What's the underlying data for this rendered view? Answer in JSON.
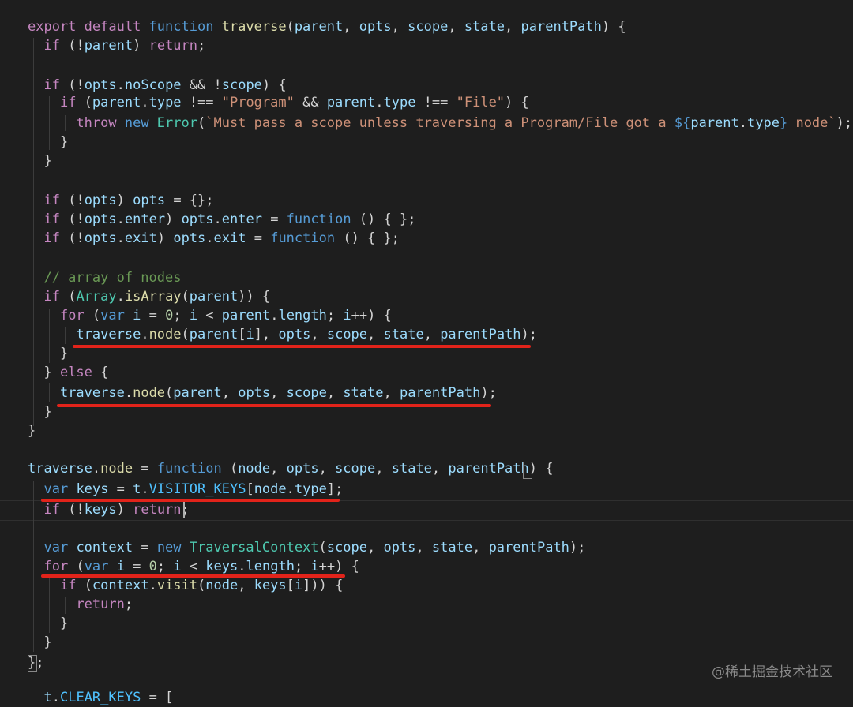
{
  "code_lines": [
    [
      [
        "export ",
        "kw"
      ],
      [
        "default ",
        "kw"
      ],
      [
        "function ",
        "st"
      ],
      [
        "traverse",
        "fn"
      ],
      [
        "(",
        "pl"
      ],
      [
        "parent",
        "var"
      ],
      [
        ", ",
        "pl"
      ],
      [
        "opts",
        "var"
      ],
      [
        ", ",
        "pl"
      ],
      [
        "scope",
        "var"
      ],
      [
        ", ",
        "pl"
      ],
      [
        "state",
        "var"
      ],
      [
        ", ",
        "pl"
      ],
      [
        "parentPath",
        "var"
      ],
      [
        ") {",
        "pl"
      ]
    ],
    [
      [
        "  ",
        "pl"
      ],
      [
        "if ",
        "kw"
      ],
      [
        "(!",
        "pl"
      ],
      [
        "parent",
        "var"
      ],
      [
        ") ",
        "pl"
      ],
      [
        "return",
        "kw"
      ],
      [
        ";",
        "pl"
      ]
    ],
    [],
    [
      [
        "  ",
        "pl"
      ],
      [
        "if ",
        "kw"
      ],
      [
        "(!",
        "pl"
      ],
      [
        "opts",
        "var"
      ],
      [
        ".",
        "pl"
      ],
      [
        "noScope",
        "var"
      ],
      [
        " && !",
        "pl"
      ],
      [
        "scope",
        "var"
      ],
      [
        ") {",
        "pl"
      ]
    ],
    [
      [
        "    ",
        "pl"
      ],
      [
        "if ",
        "kw"
      ],
      [
        "(",
        "pl"
      ],
      [
        "parent",
        "var"
      ],
      [
        ".",
        "pl"
      ],
      [
        "type",
        "var"
      ],
      [
        " !== ",
        "pl"
      ],
      [
        "\"Program\"",
        "str"
      ],
      [
        " && ",
        "pl"
      ],
      [
        "parent",
        "var"
      ],
      [
        ".",
        "pl"
      ],
      [
        "type",
        "var"
      ],
      [
        " !== ",
        "pl"
      ],
      [
        "\"File\"",
        "str"
      ],
      [
        ") {",
        "pl"
      ]
    ],
    [
      [
        "      ",
        "pl"
      ],
      [
        "throw ",
        "kw"
      ],
      [
        "new ",
        "st"
      ],
      [
        "Error",
        "cls"
      ],
      [
        "(",
        "pl"
      ],
      [
        "`Must pass a scope unless traversing a Program/File got a ",
        "str"
      ],
      [
        "${",
        "st"
      ],
      [
        "parent",
        "var"
      ],
      [
        ".",
        "pl"
      ],
      [
        "type",
        "var"
      ],
      [
        "}",
        "st"
      ],
      [
        " node`",
        "str"
      ],
      [
        ");",
        "pl"
      ]
    ],
    [
      [
        "    }",
        "pl"
      ]
    ],
    [
      [
        "  }",
        "pl"
      ]
    ],
    [],
    [
      [
        "  ",
        "pl"
      ],
      [
        "if ",
        "kw"
      ],
      [
        "(!",
        "pl"
      ],
      [
        "opts",
        "var"
      ],
      [
        ") ",
        "pl"
      ],
      [
        "opts",
        "var"
      ],
      [
        " = {};",
        "pl"
      ]
    ],
    [
      [
        "  ",
        "pl"
      ],
      [
        "if ",
        "kw"
      ],
      [
        "(!",
        "pl"
      ],
      [
        "opts",
        "var"
      ],
      [
        ".",
        "pl"
      ],
      [
        "enter",
        "var"
      ],
      [
        ") ",
        "pl"
      ],
      [
        "opts",
        "var"
      ],
      [
        ".",
        "pl"
      ],
      [
        "enter",
        "var"
      ],
      [
        " = ",
        "pl"
      ],
      [
        "function",
        "st"
      ],
      [
        " () { };",
        "pl"
      ]
    ],
    [
      [
        "  ",
        "pl"
      ],
      [
        "if ",
        "kw"
      ],
      [
        "(!",
        "pl"
      ],
      [
        "opts",
        "var"
      ],
      [
        ".",
        "pl"
      ],
      [
        "exit",
        "var"
      ],
      [
        ") ",
        "pl"
      ],
      [
        "opts",
        "var"
      ],
      [
        ".",
        "pl"
      ],
      [
        "exit",
        "var"
      ],
      [
        " = ",
        "pl"
      ],
      [
        "function",
        "st"
      ],
      [
        " () { };",
        "pl"
      ]
    ],
    [],
    [
      [
        "  // array of nodes",
        "cmt"
      ]
    ],
    [
      [
        "  ",
        "pl"
      ],
      [
        "if ",
        "kw"
      ],
      [
        "(",
        "pl"
      ],
      [
        "Array",
        "cls"
      ],
      [
        ".",
        "pl"
      ],
      [
        "isArray",
        "fn"
      ],
      [
        "(",
        "pl"
      ],
      [
        "parent",
        "var"
      ],
      [
        ")) {",
        "pl"
      ]
    ],
    [
      [
        "    ",
        "pl"
      ],
      [
        "for ",
        "kw"
      ],
      [
        "(",
        "pl"
      ],
      [
        "var ",
        "st"
      ],
      [
        "i",
        "var"
      ],
      [
        " = ",
        "pl"
      ],
      [
        "0",
        "num"
      ],
      [
        "; ",
        "pl"
      ],
      [
        "i",
        "var"
      ],
      [
        " < ",
        "pl"
      ],
      [
        "parent",
        "var"
      ],
      [
        ".",
        "pl"
      ],
      [
        "length",
        "var"
      ],
      [
        "; ",
        "pl"
      ],
      [
        "i",
        "var"
      ],
      [
        "++) {",
        "pl"
      ]
    ],
    [
      [
        "      ",
        "pl"
      ],
      [
        "traverse",
        "var"
      ],
      [
        ".",
        "pl"
      ],
      [
        "node",
        "fn"
      ],
      [
        "(",
        "pl"
      ],
      [
        "parent",
        "var"
      ],
      [
        "[",
        "pl"
      ],
      [
        "i",
        "var"
      ],
      [
        "], ",
        "pl"
      ],
      [
        "opts",
        "var"
      ],
      [
        ", ",
        "pl"
      ],
      [
        "scope",
        "var"
      ],
      [
        ", ",
        "pl"
      ],
      [
        "state",
        "var"
      ],
      [
        ", ",
        "pl"
      ],
      [
        "parentPath",
        "var"
      ],
      [
        ");",
        "pl"
      ]
    ],
    [
      [
        "    }",
        "pl"
      ]
    ],
    [
      [
        "  } ",
        "pl"
      ],
      [
        "else",
        "kw"
      ],
      [
        " {",
        "pl"
      ]
    ],
    [
      [
        "    ",
        "pl"
      ],
      [
        "traverse",
        "var"
      ],
      [
        ".",
        "pl"
      ],
      [
        "node",
        "fn"
      ],
      [
        "(",
        "pl"
      ],
      [
        "parent",
        "var"
      ],
      [
        ", ",
        "pl"
      ],
      [
        "opts",
        "var"
      ],
      [
        ", ",
        "pl"
      ],
      [
        "scope",
        "var"
      ],
      [
        ", ",
        "pl"
      ],
      [
        "state",
        "var"
      ],
      [
        ", ",
        "pl"
      ],
      [
        "parentPath",
        "var"
      ],
      [
        ");",
        "pl"
      ]
    ],
    [
      [
        "  }",
        "pl"
      ]
    ],
    [
      [
        "}",
        "pl"
      ]
    ],
    [],
    [
      [
        "traverse",
        "var"
      ],
      [
        ".",
        "pl"
      ],
      [
        "node",
        "fn"
      ],
      [
        " = ",
        "pl"
      ],
      [
        "function",
        "st"
      ],
      [
        " (",
        "pl"
      ],
      [
        "node",
        "var"
      ],
      [
        ", ",
        "pl"
      ],
      [
        "opts",
        "var"
      ],
      [
        ", ",
        "pl"
      ],
      [
        "scope",
        "var"
      ],
      [
        ", ",
        "pl"
      ],
      [
        "state",
        "var"
      ],
      [
        ", ",
        "pl"
      ],
      [
        "parentPath",
        "var"
      ],
      [
        ") {",
        "pl"
      ]
    ],
    [
      [
        "  ",
        "pl"
      ],
      [
        "var ",
        "st"
      ],
      [
        "keys",
        "var"
      ],
      [
        " = ",
        "pl"
      ],
      [
        "t",
        "var"
      ],
      [
        ".",
        "pl"
      ],
      [
        "VISITOR_KEYS",
        "const"
      ],
      [
        "[",
        "pl"
      ],
      [
        "node",
        "var"
      ],
      [
        ".",
        "pl"
      ],
      [
        "type",
        "var"
      ],
      [
        "];",
        "pl"
      ]
    ],
    [
      [
        "  ",
        "pl"
      ],
      [
        "if ",
        "kw"
      ],
      [
        "(!",
        "pl"
      ],
      [
        "keys",
        "var"
      ],
      [
        ") ",
        "pl"
      ],
      [
        "return",
        "kw"
      ],
      [
        ";",
        "pl"
      ]
    ],
    [],
    [
      [
        "  ",
        "pl"
      ],
      [
        "var ",
        "st"
      ],
      [
        "context",
        "var"
      ],
      [
        " = ",
        "pl"
      ],
      [
        "new ",
        "st"
      ],
      [
        "TraversalContext",
        "cls"
      ],
      [
        "(",
        "pl"
      ],
      [
        "scope",
        "var"
      ],
      [
        ", ",
        "pl"
      ],
      [
        "opts",
        "var"
      ],
      [
        ", ",
        "pl"
      ],
      [
        "state",
        "var"
      ],
      [
        ", ",
        "pl"
      ],
      [
        "parentPath",
        "var"
      ],
      [
        ");",
        "pl"
      ]
    ],
    [
      [
        "  ",
        "pl"
      ],
      [
        "for ",
        "kw"
      ],
      [
        "(",
        "pl"
      ],
      [
        "var ",
        "st"
      ],
      [
        "i",
        "var"
      ],
      [
        " = ",
        "pl"
      ],
      [
        "0",
        "num"
      ],
      [
        "; ",
        "pl"
      ],
      [
        "i",
        "var"
      ],
      [
        " < ",
        "pl"
      ],
      [
        "keys",
        "var"
      ],
      [
        ".",
        "pl"
      ],
      [
        "length",
        "var"
      ],
      [
        "; ",
        "pl"
      ],
      [
        "i",
        "var"
      ],
      [
        "++) {",
        "pl"
      ]
    ],
    [
      [
        "    ",
        "pl"
      ],
      [
        "if ",
        "kw"
      ],
      [
        "(",
        "pl"
      ],
      [
        "context",
        "var"
      ],
      [
        ".",
        "pl"
      ],
      [
        "visit",
        "fn"
      ],
      [
        "(",
        "pl"
      ],
      [
        "node",
        "var"
      ],
      [
        ", ",
        "pl"
      ],
      [
        "keys",
        "var"
      ],
      [
        "[",
        "pl"
      ],
      [
        "i",
        "var"
      ],
      [
        "])) {",
        "pl"
      ]
    ],
    [
      [
        "      ",
        "pl"
      ],
      [
        "return",
        "kw"
      ],
      [
        ";",
        "pl"
      ]
    ],
    [
      [
        "    }",
        "pl"
      ]
    ],
    [
      [
        "  }",
        "pl"
      ]
    ],
    [
      [
        "};",
        "pl"
      ]
    ],
    [],
    [
      [
        "  ",
        "pl"
      ],
      [
        "t",
        "var"
      ],
      [
        ".",
        "pl"
      ],
      [
        "CLEAR_KEYS",
        "const"
      ],
      [
        " = [",
        "pl"
      ]
    ]
  ],
  "watermark": "@稀土掘金技术社区"
}
